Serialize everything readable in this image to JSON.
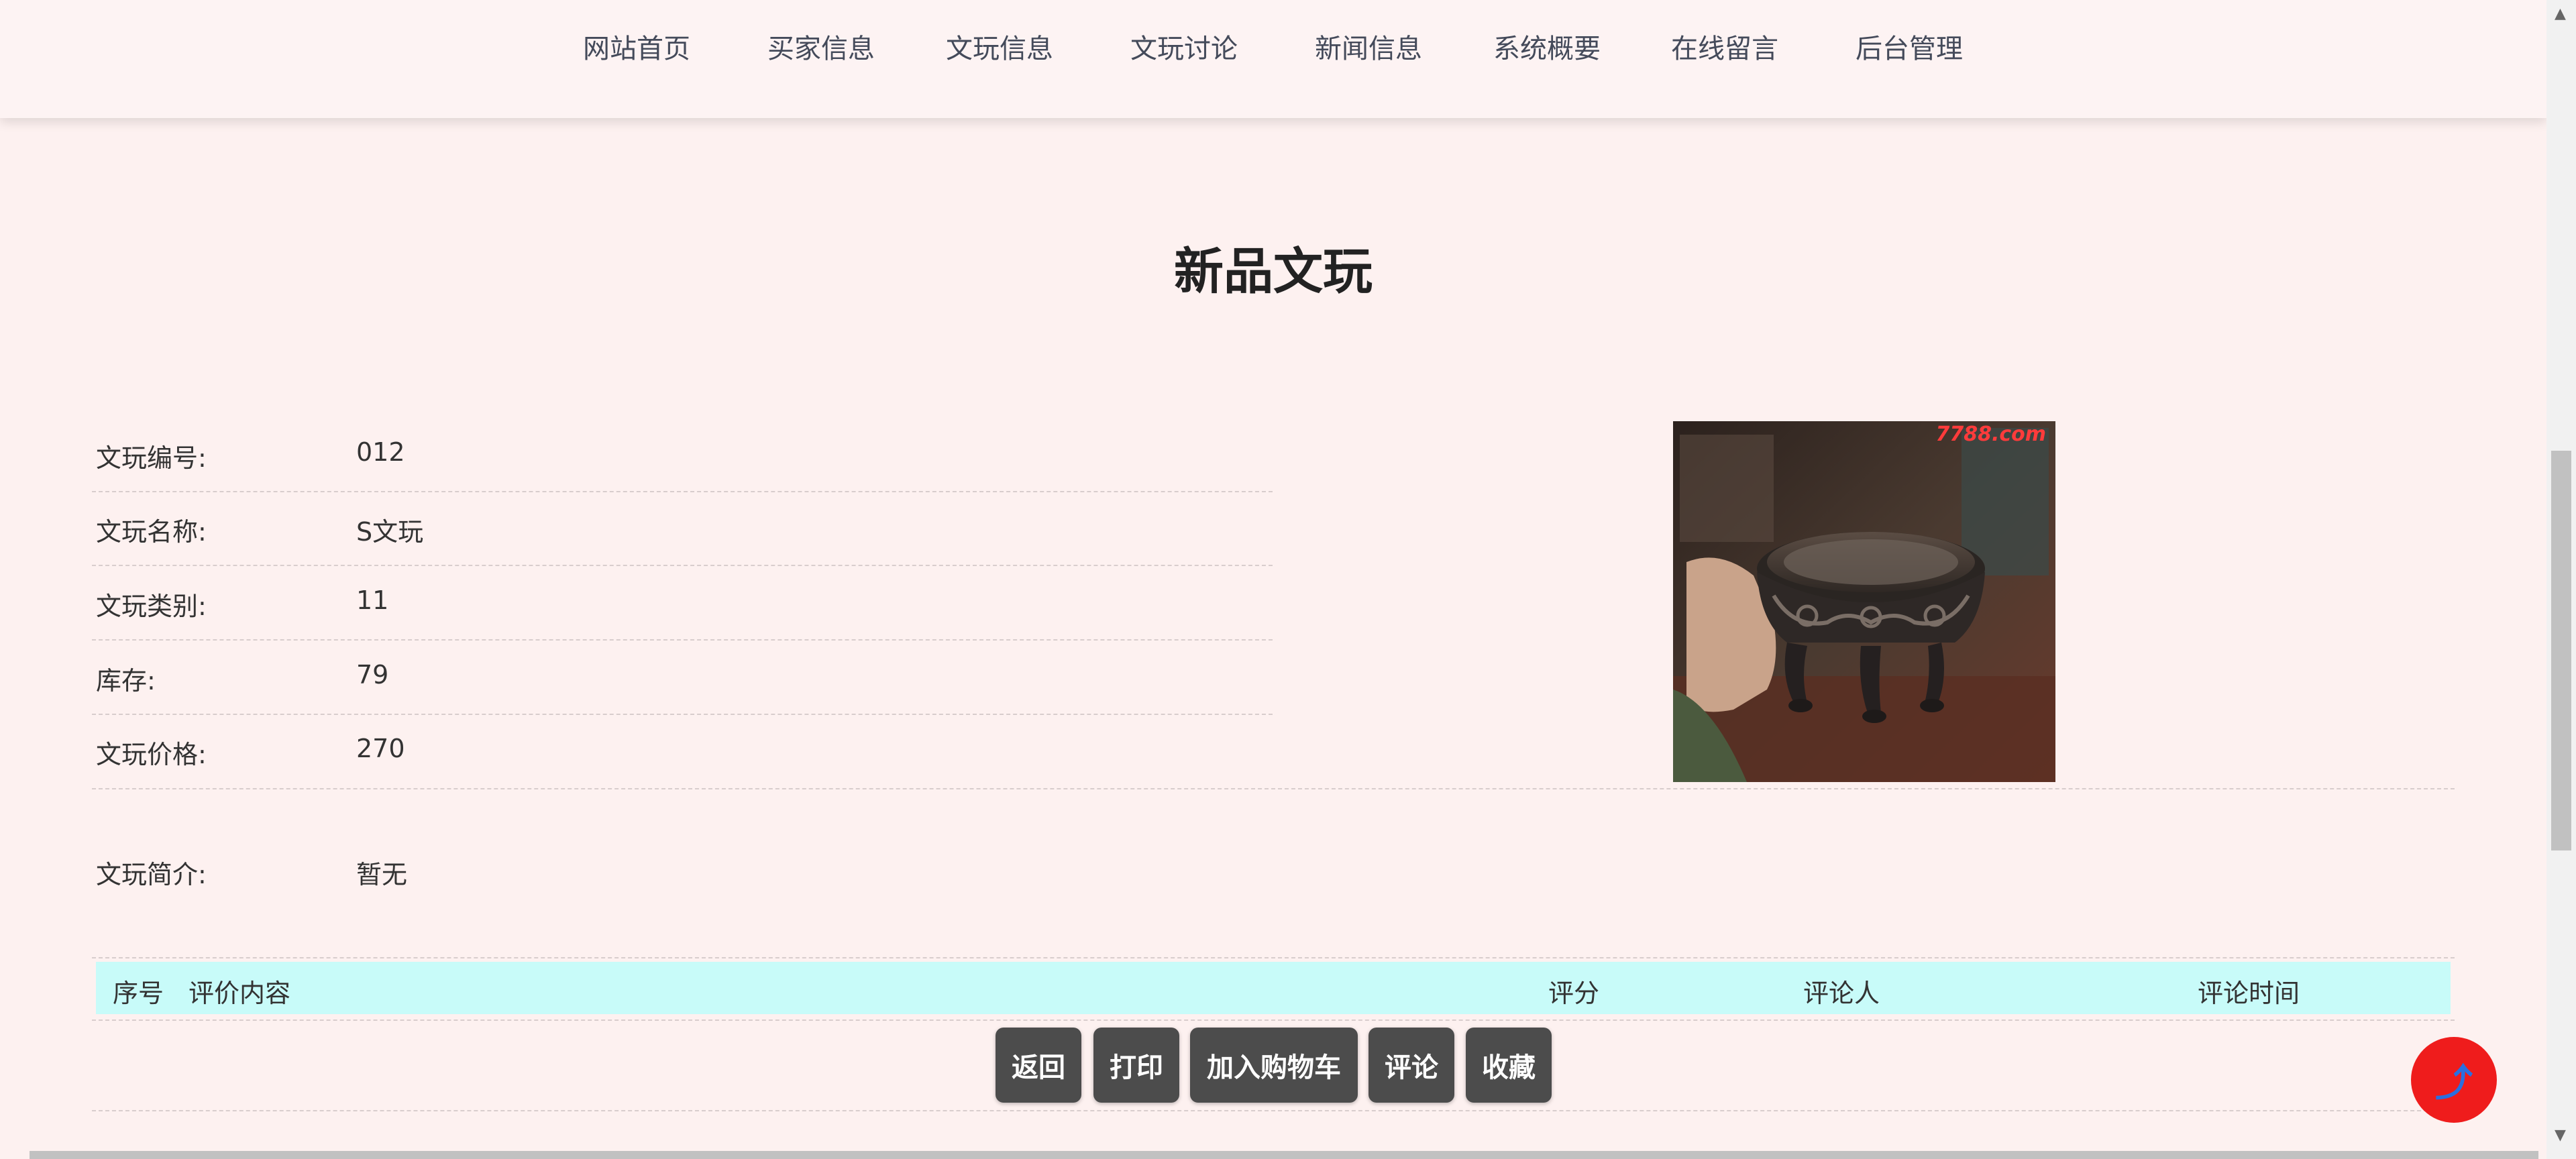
{
  "nav": {
    "items": [
      "网站首页",
      "买家信息",
      "文玩信息",
      "文玩讨论",
      "新闻信息",
      "系统概要",
      "在线留言",
      "后台管理"
    ]
  },
  "page": {
    "title": "新品文玩"
  },
  "details": {
    "rows": [
      {
        "label": "文玩编号:",
        "value": "012"
      },
      {
        "label": "文玩名称:",
        "value": "S文玩"
      },
      {
        "label": "文玩类别:",
        "value": "11"
      },
      {
        "label": "库存:",
        "value": "79"
      },
      {
        "label": "文玩价格:",
        "value": "270"
      }
    ],
    "intro_label": "文玩简介:",
    "intro_value": "暂无"
  },
  "photo": {
    "watermark": "7788.com"
  },
  "reviews": {
    "columns": [
      "序号",
      "评价内容",
      "评分",
      "评论人",
      "评论时间"
    ]
  },
  "actions": {
    "back": "返回",
    "print": "打印",
    "add_to_cart": "加入购物车",
    "comment": "评论",
    "favorite": "收藏"
  },
  "scroll_top": {
    "icon": "⤴"
  },
  "colors": {
    "page_bg": "#fdf1f0",
    "table_header_bg": "#c8fbf9",
    "button_bg": "#4c4c4c",
    "scroll_top_bg": "#ef1c1c"
  }
}
